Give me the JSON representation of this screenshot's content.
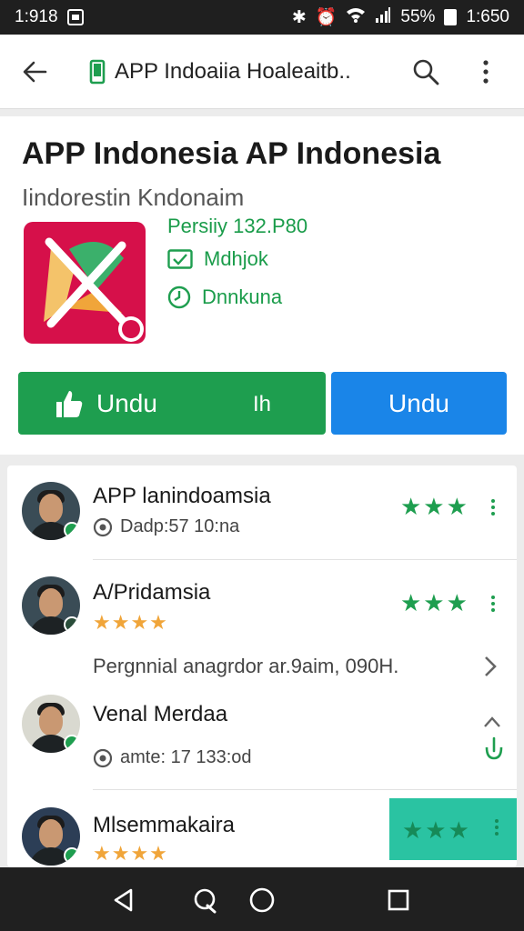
{
  "status_bar": {
    "time_left": "1:918",
    "battery": "55%",
    "time_right": "1:650"
  },
  "app_bar": {
    "title": "APP Indoaiia  Hoaleaitb..",
    "icons": [
      "back-arrow-icon",
      "phone-icon",
      "search-icon",
      "more-vert-icon"
    ]
  },
  "app": {
    "title": "APP Indonesia AP Indonesia",
    "subtitle": "Iindorestin Kndonaim",
    "meta": {
      "line1": "Persiiy 132.P80",
      "line2": "Mdhjok",
      "line3": "Dnnkuna"
    },
    "colors": {
      "icon_bg": "#d6104a",
      "green": "#1e9e4f",
      "blue": "#1a85e8"
    }
  },
  "buttons": {
    "install_label": "Undu",
    "install_label2": "Ih",
    "open_label": "Undu"
  },
  "reviews": [
    {
      "name": "APP lanindoamsia",
      "sub": "Dadp:57 10:na",
      "stars": "★★★",
      "type": "green"
    },
    {
      "name": "A/Pridamsia",
      "stars": "★★★★",
      "green_stars": "★★★",
      "comment": "Pergnnial anagrdor ar.9aim, 090H."
    },
    {
      "name": "Venal Merdaa",
      "sub": "amte: 17 133:od"
    },
    {
      "name": "Mlsemmakaira",
      "stars": "★★★★",
      "green_stars": "★★★"
    }
  ],
  "nav": {
    "icons": [
      "back-triangle-icon",
      "assistant-icon",
      "home-circle-icon",
      "recents-square-icon"
    ]
  }
}
